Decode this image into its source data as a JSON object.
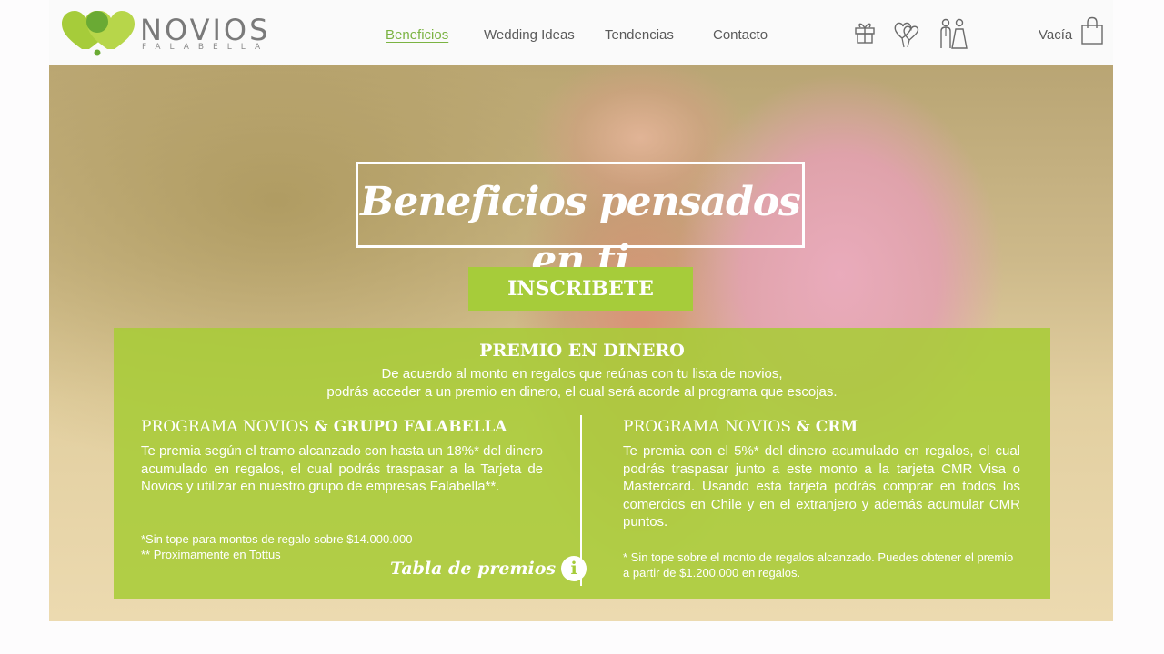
{
  "brand": {
    "name": "NOVIOS",
    "sub": "FALABELLA"
  },
  "nav": {
    "items": [
      {
        "label": "Beneficios",
        "active": true
      },
      {
        "label": "Wedding Ideas",
        "active": false
      },
      {
        "label": "Tendencias",
        "active": false
      },
      {
        "label": "Contacto",
        "active": false
      }
    ]
  },
  "header_icons": [
    "gift-icon",
    "hearts-icon",
    "couple-icon",
    "shopping-bag-icon"
  ],
  "cart": {
    "label": "Vacía"
  },
  "hero": {
    "title": "Beneficios pensados en ti",
    "cta_label": "INSCRIBETE"
  },
  "panel": {
    "title": "PREMIO EN DINERO",
    "intro_line1": "De acuerdo al monto en regalos que reúnas con tu lista de novios,",
    "intro_line2": "podrás acceder a un premio en dinero, el cual será acorde al programa que escojas.",
    "left": {
      "head_light": "PROGRAMA NOVIOS ",
      "head_bold": "& GRUPO FALABELLA",
      "body": "Te premia según el tramo alcanzado con hasta un 18%* del dinero acumulado en regalos, el cual podrás traspasar a la Tarjeta de Novios y utilizar en nuestro grupo de empresas Falabella**.",
      "note1": "*Sin tope para montos de regalo sobre $14.000.000",
      "note2": "** Proximamente en Tottus",
      "link_label": "Tabla de premios"
    },
    "right": {
      "head_light": "PROGRAMA NOVIOS ",
      "head_bold": "& CRM",
      "body": "Te premia con el 5%* del dinero acumulado en regalos, el cual podrás traspasar junto a este monto a la tarjeta CMR Visa o Mastercard. Usando esta tarjeta podrás comprar en todos los comercios en Chile y en el extranjero y además acumular CMR puntos.",
      "note": "* Sin tope sobre el monto de regalos alcanzado. Puedes obtener el premio a partir de $1.200.000 en regalos."
    }
  },
  "colors": {
    "accent": "#a6cc3a",
    "nav_active": "#7bb342",
    "text": "#5a5a5a"
  }
}
